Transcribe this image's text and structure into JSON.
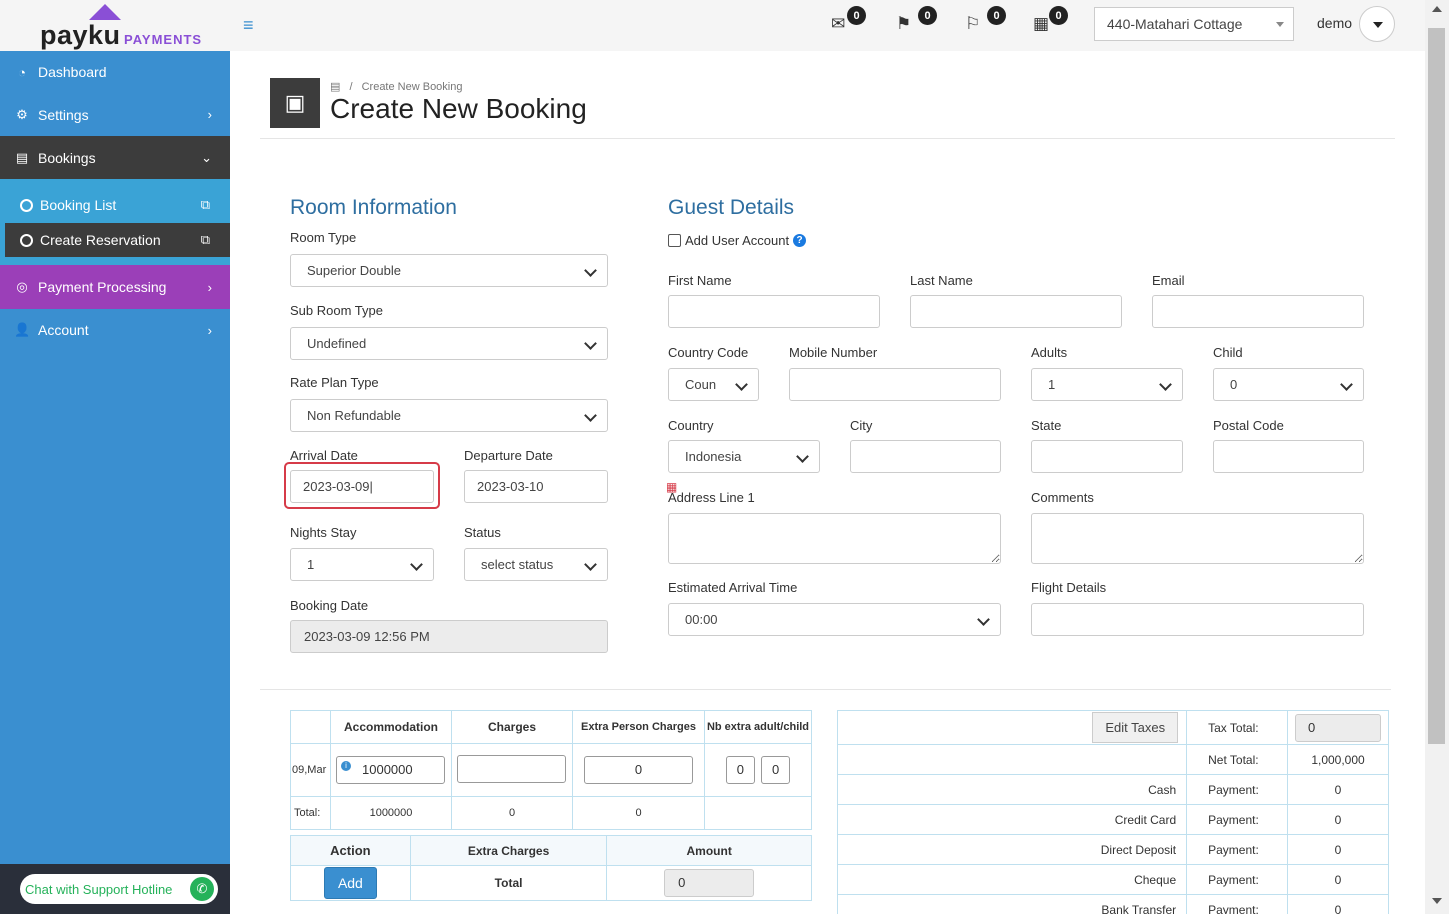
{
  "brand": {
    "name": "payku",
    "suffix": "PAYMENTS"
  },
  "sidebar": {
    "dashboard": "Dashboard",
    "settings": "Settings",
    "bookings": "Bookings",
    "booking_list": "Booking List",
    "create_reservation": "Create Reservation",
    "payment_processing": "Payment Processing",
    "account": "Account",
    "support": "Chat with Support Hotline"
  },
  "topbar": {
    "badges": [
      "0",
      "0",
      "0",
      "0"
    ],
    "property": "440-Matahari Cottage",
    "user": "demo"
  },
  "header": {
    "breadcrumb": "Create New Booking",
    "title": "Create New Booking"
  },
  "room": {
    "title": "Room Information",
    "room_type_label": "Room Type",
    "room_type": "Superior Double",
    "sub_room_type_label": "Sub Room Type",
    "sub_room_type": "Undefined",
    "rate_plan_label": "Rate Plan Type",
    "rate_plan": "Non Refundable",
    "arrival_label": "Arrival Date",
    "arrival": "2023-03-09",
    "departure_label": "Departure Date",
    "departure": "2023-03-10",
    "nights_label": "Nights Stay",
    "nights": "1",
    "status_label": "Status",
    "status": "select status",
    "booking_date_label": "Booking Date",
    "booking_date": "2023-03-09 12:56 PM"
  },
  "guest": {
    "title": "Guest Details",
    "add_user": "Add User Account",
    "first_name": "First Name",
    "last_name": "Last Name",
    "email": "Email",
    "country_code": "Country Code",
    "country_code_value": "Coun",
    "mobile": "Mobile Number",
    "adults": "Adults",
    "adults_value": "1",
    "child": "Child",
    "child_value": "0",
    "country": "Country",
    "country_value": "Indonesia",
    "city": "City",
    "state": "State",
    "postal": "Postal Code",
    "address": "Address Line 1",
    "comments": "Comments",
    "eta": "Estimated Arrival Time",
    "eta_value": "00:00",
    "flight": "Flight Details"
  },
  "charges_table": {
    "headers": [
      "Accommodation",
      "Charges",
      "Extra Person Charges",
      "Nb extra adult/child"
    ],
    "date": "09,Mar",
    "accommodation": "1000000",
    "extra_person": "0",
    "extra_adult": "0",
    "extra_child": "0",
    "total_label": "Total:",
    "totals": [
      "1000000",
      "0",
      "0"
    ]
  },
  "extra_table": {
    "headers": [
      "Action",
      "Extra Charges",
      "Amount"
    ],
    "add": "Add",
    "total": "Total",
    "amount": "0"
  },
  "summary": {
    "edit_taxes": "Edit Taxes",
    "tax_total_label": "Tax Total:",
    "tax_total": "0",
    "net_total_label": "Net Total:",
    "net_total": "1,000,000",
    "payment_label": "Payment:",
    "payments": [
      {
        "method": "Cash",
        "amount": "0"
      },
      {
        "method": "Credit Card",
        "amount": "0"
      },
      {
        "method": "Direct Deposit",
        "amount": "0"
      },
      {
        "method": "Cheque",
        "amount": "0"
      },
      {
        "method": "Bank Transfer",
        "amount": "0"
      }
    ]
  }
}
